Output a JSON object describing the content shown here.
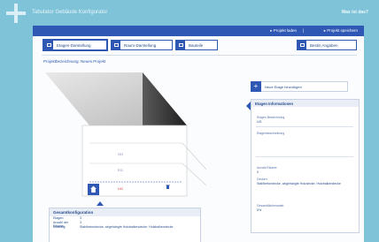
{
  "app": {
    "title": "Tabulator Gebäude Konfigurator",
    "help": "Was ist das?"
  },
  "actions": {
    "load": "▸ Projekt laden",
    "separator": "|",
    "save": "▸ Projekt speichern"
  },
  "tabs": [
    {
      "label": "Etagen-Darstellung",
      "icon": "floors-icon",
      "active": true
    },
    {
      "label": "Raum-Darstellung",
      "icon": "room-icon",
      "active": false
    },
    {
      "label": "Bauteile",
      "icon": "components-icon",
      "active": false
    },
    {
      "label": "Bestin Angaben",
      "icon": "settings-icon",
      "active": false
    }
  ],
  "project": {
    "name": "Projektbezeichnung: Neues Projekt"
  },
  "building": {
    "floors": [
      {
        "label": "OG"
      },
      {
        "label": "EG"
      },
      {
        "label": "UG",
        "active": true
      }
    ],
    "delete_icon": "trash-icon"
  },
  "summary": {
    "title": "Gesamtkonfiguration",
    "rows": [
      {
        "k": "Etagen:",
        "v": "3"
      },
      {
        "k": "Anzahl der Räume:",
        "v": "3"
      },
      {
        "k": "Nutzung:",
        "v": "Stahlbetondecke, abgehängte Holzbalkendecke, Holzbalkendecke"
      }
    ]
  },
  "add_floor": {
    "label": "Neue Etage hinzufügen",
    "icon": "plus-icon"
  },
  "info": {
    "title": "Etagen Informationen",
    "fields": [
      {
        "label": "Etagen Bezeichnung",
        "value": "UG"
      },
      {
        "label": "Etagenbeschreibung",
        "value": ""
      },
      {
        "label": "Anzahl Räume:",
        "value": "0"
      },
      {
        "label": "Decken:",
        "value": "Stahlbetondecke, abgehängte Holzdecke, Holzbalkendecke"
      },
      {
        "label": "Gesamtflächenantei:",
        "value": "0%"
      }
    ]
  },
  "colors": {
    "accent": "#2e58b4",
    "background": "#7fc3d8",
    "active_floor": "#d0352b"
  }
}
